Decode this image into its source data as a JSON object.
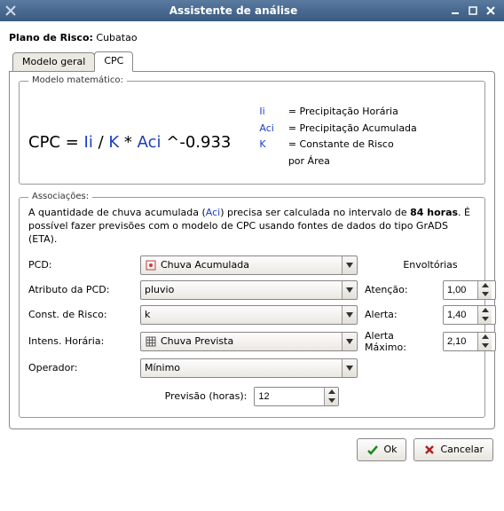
{
  "window": {
    "title": "Assistente de análise"
  },
  "risk_plan": {
    "label": "Plano de Risco:",
    "value": "Cubatao"
  },
  "tabs": {
    "general": "Modelo geral",
    "cpc": "CPC"
  },
  "fieldset_math": {
    "legend": "Modelo matemático:",
    "formula_prefix": "CPC = ",
    "li": "Ii",
    "sep1": " / ",
    "k": "K",
    "sep2": " * ",
    "aci": "Aci",
    "exp": " ^-0.933",
    "legend_rows": {
      "li_label": "Ii",
      "li_desc": "= Precipitação Horária",
      "aci_label": "Aci",
      "aci_desc": "= Precipitação Acumulada",
      "k_label": "K",
      "k_desc": "= Constante de Risco",
      "k_desc2": "   por Área"
    }
  },
  "fieldset_assoc": {
    "legend": "Associações:",
    "desc_part1": "A quantidade de chuva acumulada (",
    "desc_aci": "Aci",
    "desc_part2": ") precisa ser calculada no intervalo de ",
    "desc_hours": "84 horas",
    "desc_part3": ". É possível fazer previsões com o modelo de CPC usando fontes de dados do tipo GrADS (ETA).",
    "labels": {
      "pcd": "PCD:",
      "attr": "Atributo da PCD:",
      "const": "Const. de Risco:",
      "intens": "Intens. Horária:",
      "operator": "Operador:",
      "env_header": "Envoltórias",
      "atencao": "Atenção:",
      "alerta": "Alerta:",
      "alerta_max": "Alerta Máximo:",
      "previsao": "Previsão (horas):"
    },
    "fields": {
      "pcd": "Chuva Acumulada",
      "attr": "pluvio",
      "const": "k",
      "intens": "Chuva Prevista",
      "operator": "Mínimo",
      "atencao": "1,00",
      "alerta": "1,40",
      "alerta_max": "2,10",
      "previsao": "12"
    }
  },
  "buttons": {
    "ok": "Ok",
    "cancel": "Cancelar"
  }
}
